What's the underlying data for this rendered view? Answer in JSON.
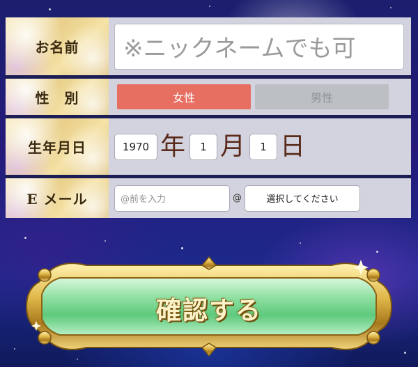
{
  "form": {
    "name": {
      "label": "お名前",
      "placeholder": "※ニックネームでも可"
    },
    "gender": {
      "label": "性　別",
      "options": [
        "女性",
        "男性"
      ],
      "selected": "女性"
    },
    "birth": {
      "label": "生年月日",
      "year": "1970",
      "year_unit": "年",
      "month": "1",
      "month_unit": "月",
      "day": "1",
      "day_unit": "日"
    },
    "email": {
      "label": "E メール",
      "local_placeholder": "@前を入力",
      "at": "@",
      "domain_placeholder": "選択してください"
    }
  },
  "submit": {
    "label": "確認する"
  },
  "colors": {
    "selected_gender": "#e66f62",
    "unselected_gender": "#bcc0c4",
    "label_gold": "#e9cf8a",
    "value_bg": "#d3d3df",
    "button_green": "#8fe0a2",
    "button_frame_gold": "#d9b040"
  }
}
